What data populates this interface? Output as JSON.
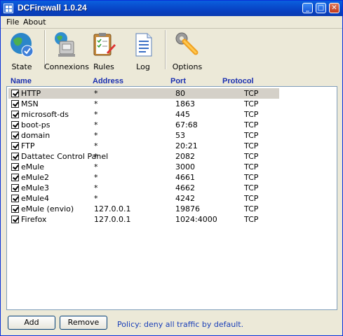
{
  "window": {
    "title": "DCFirewall 1.0.24"
  },
  "menu": [
    "File",
    "About"
  ],
  "toolbar": [
    {
      "label": "State",
      "icon": "state-globe-icon"
    },
    {
      "label": "Connexions",
      "icon": "connexions-network-icon"
    },
    {
      "label": "Rules",
      "icon": "rules-clipboard-icon"
    },
    {
      "label": "Log",
      "icon": "log-document-icon"
    },
    {
      "label": "Options",
      "icon": "options-wrench-icon"
    }
  ],
  "columns": [
    "Name",
    "Address",
    "Port",
    "Protocol"
  ],
  "rows": [
    {
      "name": "HTTP",
      "address": "*",
      "port": "80",
      "protocol": "TCP",
      "checked": true
    },
    {
      "name": "MSN",
      "address": "*",
      "port": "1863",
      "protocol": "TCP",
      "checked": true
    },
    {
      "name": "microsoft-ds",
      "address": "*",
      "port": "445",
      "protocol": "TCP",
      "checked": true
    },
    {
      "name": "boot-ps",
      "address": "*",
      "port": "67:68",
      "protocol": "TCP",
      "checked": true
    },
    {
      "name": "domain",
      "address": "*",
      "port": "53",
      "protocol": "TCP",
      "checked": true
    },
    {
      "name": "FTP",
      "address": "*",
      "port": "20:21",
      "protocol": "TCP",
      "checked": true
    },
    {
      "name": "Dattatec Control Panel",
      "address": "*",
      "port": "2082",
      "protocol": "TCP",
      "checked": true
    },
    {
      "name": "eMule",
      "address": "*",
      "port": "3000",
      "protocol": "TCP",
      "checked": true
    },
    {
      "name": "eMule2",
      "address": "*",
      "port": "4661",
      "protocol": "TCP",
      "checked": true
    },
    {
      "name": "eMule3",
      "address": "*",
      "port": "4662",
      "protocol": "TCP",
      "checked": true
    },
    {
      "name": "eMule4",
      "address": "*",
      "port": "4242",
      "protocol": "TCP",
      "checked": true
    },
    {
      "name": "eMule (envio)",
      "address": "127.0.0.1",
      "port": "19876",
      "protocol": "TCP",
      "checked": true
    },
    {
      "name": "Firefox",
      "address": "127.0.0.1",
      "port": "1024:4000",
      "protocol": "TCP",
      "checked": true
    }
  ],
  "buttons": {
    "add": "Add",
    "remove": "Remove"
  },
  "policy": "Policy: deny all traffic by default.",
  "colors": {
    "titlebar": "#0842c4",
    "header_text": "#1a2fb0",
    "policy_text": "#1a3fb8"
  }
}
